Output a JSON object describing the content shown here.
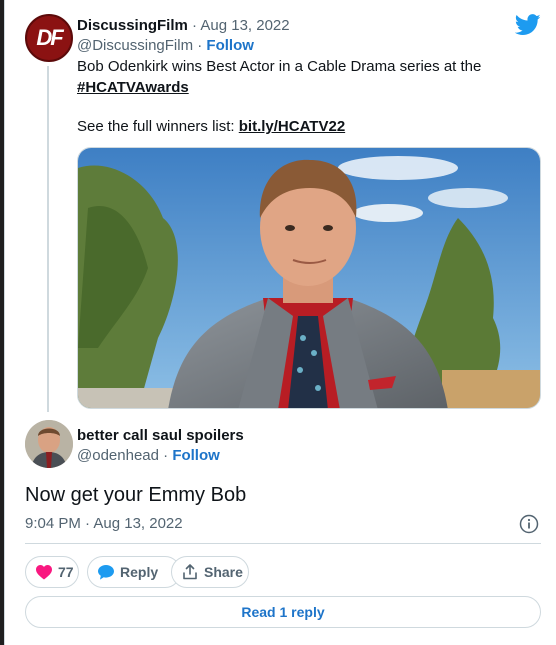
{
  "parent_tweet": {
    "author_name": "DiscussingFilm",
    "separator": "·",
    "date": "Aug 13, 2022",
    "handle": "@DiscussingFilm",
    "follow_label": "Follow",
    "text_line1": "Bob Odenkirk wins Best Actor in a Cable Drama series at the",
    "hashtag": "#HCATVAwards",
    "winners_prefix": "See the full winners list: ",
    "winners_link": "bit.ly/HCATV22",
    "avatar_logo": "DF",
    "media_icon": "photo"
  },
  "reply_tweet": {
    "author_name": "better call saul spoilers",
    "handle": "@odenhead",
    "separator": "·",
    "follow_label": "Follow",
    "text": "Now get your Emmy Bob",
    "timestamp": "9:04 PM · Aug 13, 2022"
  },
  "actions": {
    "like_count": "77",
    "reply_label": "Reply",
    "share_label": "Share",
    "read_replies_label": "Read 1 reply"
  },
  "colors": {
    "twitter_blue": "#1d9bf0",
    "link_blue": "#1d74c9",
    "like_pink": "#f91880",
    "muted": "#536471"
  },
  "icons": [
    "twitter-bird-icon",
    "info-icon",
    "heart-icon",
    "reply-bubble-icon",
    "share-icon"
  ]
}
